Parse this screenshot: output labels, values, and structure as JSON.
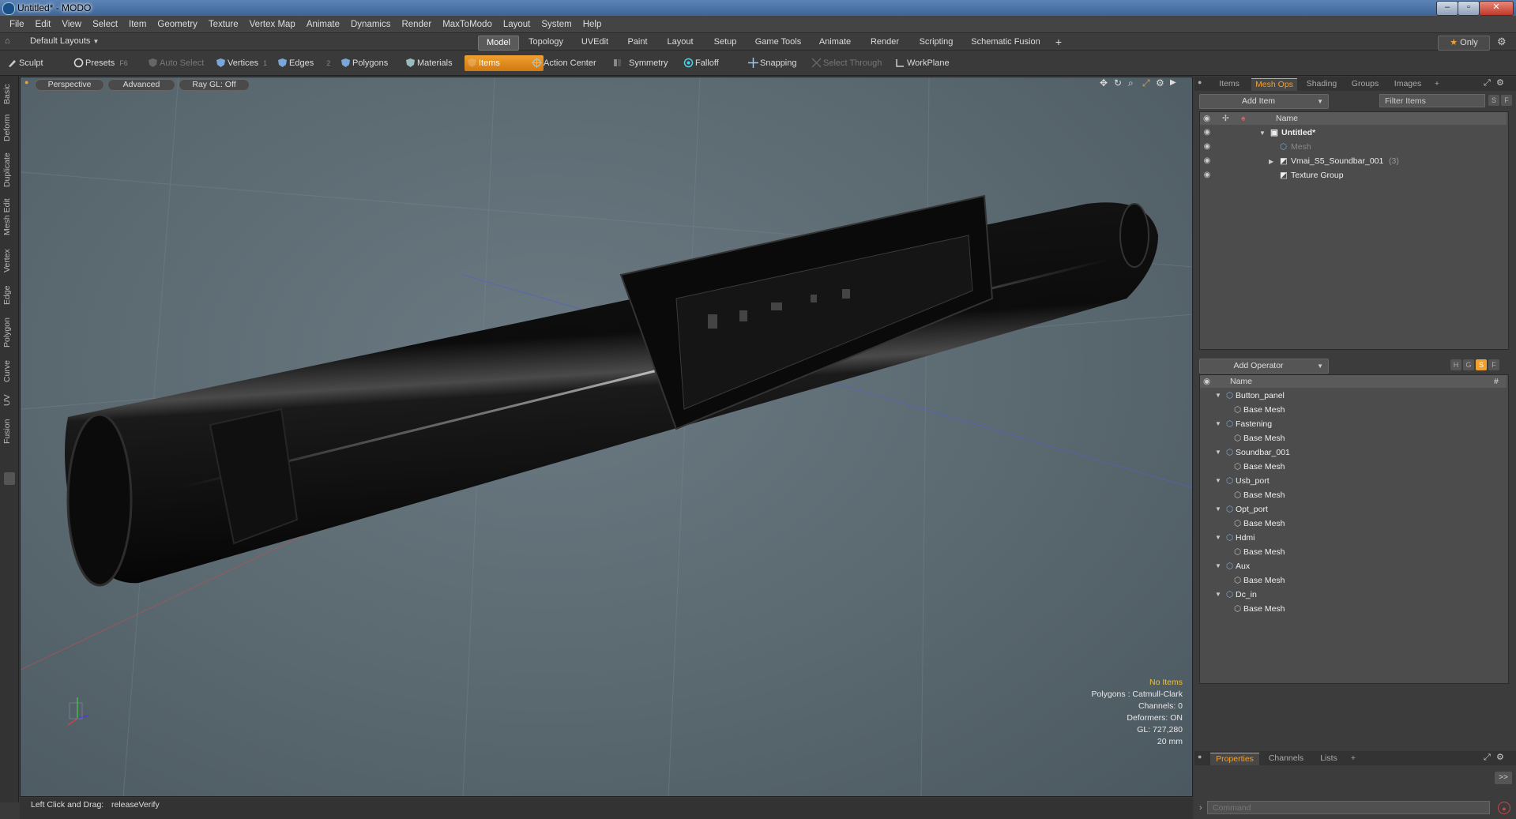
{
  "window": {
    "title": "Untitled* - MODO",
    "min": "–",
    "max": "▫",
    "close": "✕"
  },
  "menu": [
    "File",
    "Edit",
    "View",
    "Select",
    "Item",
    "Geometry",
    "Texture",
    "Vertex Map",
    "Animate",
    "Dynamics",
    "Render",
    "MaxToModo",
    "Layout",
    "System",
    "Help"
  ],
  "layoutbar": {
    "layout_select": "Default Layouts",
    "tabs": [
      "Model",
      "Topology",
      "UVEdit",
      "Paint",
      "Layout",
      "Setup",
      "Game Tools",
      "Animate",
      "Render",
      "Scripting",
      "Schematic Fusion"
    ],
    "active_tab": "Model",
    "add": "+",
    "only": "Only"
  },
  "toolbar": {
    "sculpt": "Sculpt",
    "presets": "Presets",
    "presets_key": "F6",
    "auto_select": "Auto Select",
    "vertices": "Vertices",
    "vertices_key": "1",
    "edges": "Edges",
    "edges_key": "2",
    "polygons": "Polygons",
    "materials": "Materials",
    "items": "Items",
    "action_center": "Action Center",
    "symmetry": "Symmetry",
    "falloff": "Falloff",
    "snapping": "Snapping",
    "select_through": "Select Through",
    "workplane": "WorkPlane"
  },
  "lefttabs": [
    "Basic",
    "Deform",
    "Duplicate",
    "Mesh Edit",
    "Vertex",
    "Edge",
    "Polygon",
    "Curve",
    "UV",
    "Fusion"
  ],
  "viewport": {
    "perspective": "Perspective",
    "advanced": "Advanced",
    "raygl": "Ray GL: Off",
    "info": {
      "no_items": "No Items",
      "polygons": "Polygons : Catmull-Clark",
      "channels": "Channels: 0",
      "deformers": "Deformers: ON",
      "gl": "GL: 727,280",
      "scale": "20 mm"
    }
  },
  "status": {
    "label": "Left Click and Drag:",
    "value": "releaseVerify"
  },
  "items_panel": {
    "tabs": [
      "Items",
      "Mesh Ops",
      "Shading",
      "Groups",
      "Images"
    ],
    "active_tab": "Mesh Ops",
    "add_item": "Add Item",
    "filter": "Filter Items",
    "s_btn": "S",
    "f_btn": "F",
    "col_name": "Name",
    "tree": [
      {
        "label": "Untitled*",
        "depth": 0
      },
      {
        "label": "Mesh",
        "depth": 1
      },
      {
        "label": "Vmai_S5_Soundbar_001",
        "count": "(3)",
        "depth": 1
      },
      {
        "label": "Texture Group",
        "depth": 1
      }
    ]
  },
  "ops_panel": {
    "add_operator": "Add Operator",
    "col_name": "Name",
    "col_hash": "#",
    "btn_h": "H",
    "btn_g": "G",
    "btn_s": "S",
    "btn_f": "F",
    "ops": [
      {
        "name": "Button_panel",
        "child": "Base Mesh"
      },
      {
        "name": "Fastening",
        "child": "Base Mesh"
      },
      {
        "name": "Soundbar_001",
        "child": "Base Mesh"
      },
      {
        "name": "Usb_port",
        "child": "Base Mesh"
      },
      {
        "name": "Opt_port",
        "child": "Base Mesh"
      },
      {
        "name": "Hdmi",
        "child": "Base Mesh"
      },
      {
        "name": "Aux",
        "child": "Base Mesh"
      },
      {
        "name": "Dc_in",
        "child": "Base Mesh"
      }
    ]
  },
  "bottom_panel": {
    "tabs": [
      "Properties",
      "Channels",
      "Lists"
    ],
    "active_tab": "Properties",
    "expand": ">>",
    "command_placeholder": "Command"
  },
  "colors": {
    "accent": "#f0a030",
    "viewport": "#5f6d75"
  }
}
